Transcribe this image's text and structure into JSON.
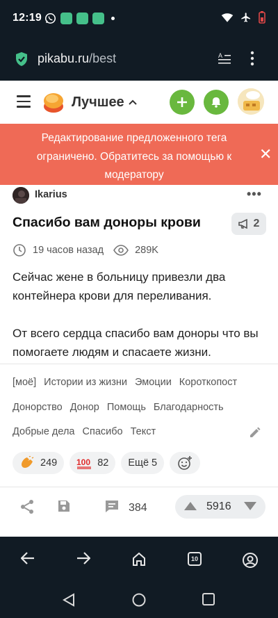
{
  "status_bar": {
    "time": "12:19",
    "battery_color": "#e04848",
    "app_icon_color": "#45c08a"
  },
  "browser": {
    "url_host": "pikabu.ru",
    "url_path": "/best",
    "tabs_count": "10"
  },
  "header": {
    "title": "Лучшее",
    "accent_color": "#69b83e"
  },
  "toast": {
    "message": "Редактирование предложенного тега ограничено. Обратитесь за помощью к модератору",
    "background": "#ef6a56"
  },
  "post": {
    "author": "Ikarius",
    "title": "Спасибо вам доноры крови",
    "comments_badge": "2",
    "time_ago": "19 часов назад",
    "views": "289K",
    "body": [
      "Сейчас жене в больницу привезли два контейнера крови для переливания.",
      "От всего сердца спасибо вам доноры что вы помогаете людям и спасаете жизни."
    ],
    "tags": [
      "[моё]",
      "Истории из жизни",
      "Эмоции",
      "Короткопост",
      "Донорство",
      "Донор",
      "Помощь",
      "Благодарность",
      "Добрые дела",
      "Спасибо",
      "Текст"
    ],
    "reactions": [
      {
        "icon": "clap-icon",
        "count": "249"
      },
      {
        "icon": "hundred-icon",
        "count": "82"
      }
    ],
    "more_reactions": "Ещё 5",
    "comments_count": "384",
    "rating": "5916"
  }
}
